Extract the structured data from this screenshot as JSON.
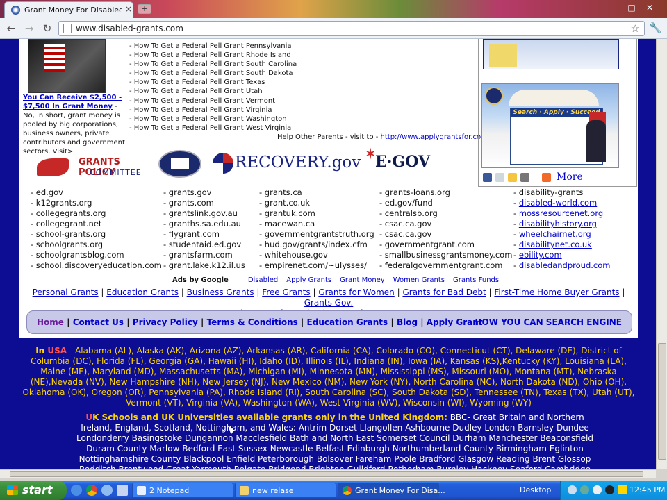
{
  "window": {
    "tab_title": "Grant Money For Disabled ...",
    "minimize": "–",
    "maximize": "□",
    "close": "✕"
  },
  "toolbar": {
    "back": "←",
    "forward": "→",
    "reload": "↻",
    "url": "www.disabled-grants.com",
    "star": "☆",
    "wrench": "🔧"
  },
  "promo": {
    "link": "You Can Receive $2,500 - $7,500 In Grant Money",
    "text": " - No, In short, grant money is pooled by big corporations, business owners, private contributors and government sectors. Visit>"
  },
  "howto_list": [
    "- How To Get a Federal Pell Grant Pennsylvania",
    "- How To Get a Federal Pell Grant Rhode Island",
    "- How To Get a Federal Pell Grant South Carolina",
    "- How To Get a Federal Pell Grant South Dakota",
    "- How To Get a Federal Pell Grant Texas",
    "- How To Get a Federal Pell Grant Utah",
    "- How To Get a Federal Pell Grant Vermont",
    "- How To Get a Federal Pell Grant Virginia",
    "- How To Get a Federal Pell Grant Washington",
    "- How To Get a Federal Pell Grant West Virginia"
  ],
  "help": {
    "text": "Help Other Parents - visit to - ",
    "link": "http://www.applygrantsfor.com"
  },
  "logos": {
    "gpc_top": "GRANTS POLICY",
    "gpc_bottom": "COMMITTEE",
    "recovery": "RECOVERY.gov",
    "egov": "E·GOV"
  },
  "share": {
    "more": "More"
  },
  "columns": {
    "c1": [
      "- ed.gov",
      "- k12grants.org",
      "- collegegrants.org",
      "- collegegrant.net",
      "- school-grants.org",
      "- schoolgrants.org",
      "- schoolgrantsblog.com",
      "- school.discoveryeducation.com"
    ],
    "c2": [
      "- grants.gov",
      "- grants.com",
      "- grantslink.gov.au",
      "- granths.sa.edu.au",
      "- flygrant.com",
      "- studentaid.ed.gov",
      "- grantsfarm.com",
      "- grant.lake.k12.il.us"
    ],
    "c3": [
      "- grants.ca",
      "- grant.co.uk",
      "- grantuk.com",
      "- macewan.ca",
      "- governmentgrantstruth.org",
      "- hud.gov/grants/index.cfm",
      "- whitehouse.gov",
      "- empirenet.com/~ulysses/"
    ],
    "c4": [
      "- grants-loans.org",
      "- ed.gov/fund",
      "- centralsb.org",
      "- csac.ca.gov",
      "- csac.ca.gov",
      "- governmentgrant.com",
      "- smallbusinessgrantsmoney.com",
      "- federalgovernmentgrant.com"
    ],
    "c5_first": "- disability-grants",
    "c5_links": [
      "disabled-world.com",
      "mossresourcenet.org",
      "disabilityhistory.org",
      "wheelchairnet.org",
      "disabilitynet.co.uk",
      "ebility.com",
      "disabledandproud.com"
    ],
    "dash": "- "
  },
  "ads": {
    "label": "Ads by Google",
    "links": [
      "Disabled",
      "Apply Grants",
      "Grant Money",
      "Women Grants",
      "Grants Funds"
    ]
  },
  "linkbar": {
    "row1": [
      "Personal Grants",
      "Education Grants",
      "Business Grants",
      "Free Grants",
      "Grants for Women",
      "Grants for Bad Debt",
      "First-Time Home Buyer Grants",
      "Grants Gov."
    ],
    "row2": [
      "General Grant Information",
      "Types of Government Grants"
    ],
    "sep": " | "
  },
  "nav": {
    "items": [
      "Home",
      "Contact Us",
      "Privacy Policy",
      "Terms & Conditions",
      "Education Grants",
      "Blog",
      "Apply Grant"
    ],
    "right": "HOW YOU CAN SEARCH ENGINE"
  },
  "states": {
    "in": "In ",
    "usa": "USA",
    "text": " - Alabama (AL), Alaska (AK), Arizona (AZ), Arkansas (AR), California (CA), Colorado (CO), Connecticut (CT), Delaware (DE), District of Columbia (DC), Florida (FL), Georgia (GA), Hawaii (HI), Idaho (ID), Illinois (IL), Indiana (IN), Iowa (IA), Kansas (KS),Kentucky (KY), Louisiana (LA), Maine (ME), Maryland (MD), Massachusetts (MA), Michigan (MI), Minnesota (MN), Mississippi (MS), Missouri (MO), Montana (MT), Nebraska (NE),Nevada (NV), New Hampshire (NH), New Jersey (NJ), New Mexico (NM), New York (NY), North Carolina (NC), North Dakota (ND), Ohio (OH), Oklahoma (OK), Oregon (OR), Pennsylvania (PA), Rhode Island (RI), South Carolina (SC), South Dakota (SD), Tennessee (TN), Texas (TX), Utah (UT), Vermont (VT), Virginia (VA), Washington (WA), West Virginia (WV), Wisconsin (WI), Wyoming (WY)"
  },
  "uk": {
    "u": "U",
    "heading": "K Schools and UK Universities available grants only in the United Kingdom:",
    "text": " BBC- Great Britain and Northern Ireland, England, Scotland, Nottingham, and Wales: Antrim Dorset Llangollen Ashbourne Dudley London Barnsley Dundee Londonderry Basingstoke Dungannon Macclesfield Bath and North East Somerset Council Durham Manchester Beaconsfield Duram County Marlow Bedford East Sussex Newcastle Belfast Edinburgh Northumberland County Birmingham Eglinton Nottinghamshire County Blackpool Enfield Peterborough Bolsover Fareham Poole Bradford Glasgow Reading Brent Glossop Redditch Brentwood Great Yarmouth Reigate Bridgend Brighton Guildford Rotherham Burnley Hackney Seaford Cambridge Harrow Sevenoaks"
  },
  "taskbar": {
    "start": "start",
    "tasks": [
      "2 Notepad",
      "new relase",
      "Grant Money For Disa..."
    ],
    "desktop": "Desktop",
    "clock": "12:45 PM"
  },
  "colors": {
    "page_blue": "#0d0d94",
    "link_blue": "#0000cc",
    "state_yellow": "#ffd600",
    "usa_red": "#ff5252"
  }
}
